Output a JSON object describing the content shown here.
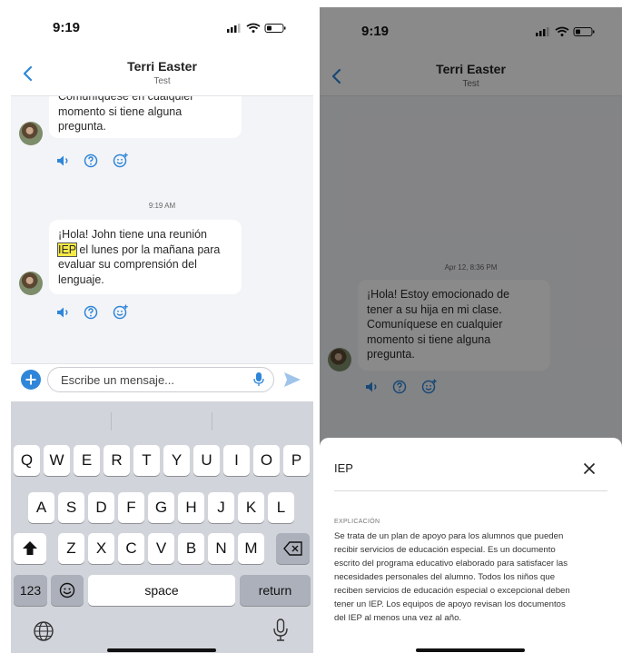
{
  "colors": {
    "accent": "#2f86d9",
    "highlight": "#f6ea47",
    "chat_bg": "#f3f4f7",
    "keyboard_bg": "#d1d4da"
  },
  "left": {
    "status_time": "9:19",
    "header_title": "Terri Easter",
    "header_subtitle": "Test",
    "message1_lines": [
      "Comuníquese en cualquier",
      "momento si tiene alguna",
      "pregunta."
    ],
    "timestamp": "9:19 AM",
    "message2": {
      "line1": "¡Hola! John tiene una reunión",
      "highlight": "IEP",
      "line2_rest": " el lunes por la mañana para",
      "line3": "evaluar su comprensión del",
      "line4": "lenguaje."
    },
    "composer_placeholder": "Escribe un mensaje...",
    "keyboard": {
      "row1": [
        "Q",
        "W",
        "E",
        "R",
        "T",
        "Y",
        "U",
        "I",
        "O",
        "P"
      ],
      "row2": [
        "A",
        "S",
        "D",
        "F",
        "G",
        "H",
        "J",
        "K",
        "L"
      ],
      "row3": [
        "Z",
        "X",
        "C",
        "V",
        "B",
        "N",
        "M"
      ],
      "numbers_label": "123",
      "space_label": "space",
      "return_label": "return"
    }
  },
  "right": {
    "status_time": "9:19",
    "header_title": "Terri Easter",
    "header_subtitle": "Test",
    "timestamp": "Apr 12, 8:36 PM",
    "message_lines": [
      "¡Hola! Estoy emocionado de",
      "tener a su hija en mi clase.",
      "Comuníquese en cualquier",
      "momento si tiene alguna",
      "pregunta."
    ],
    "sheet": {
      "title": "IEP",
      "section_label": "EXPLICACIÓN",
      "body_lines": [
        "Se trata de un plan de apoyo para los alumnos que pueden",
        "recibir servicios de educación especial. Es un documento",
        "escrito del programa educativo elaborado para satisfacer las",
        "necesidades personales del alumno. Todos los niños que",
        "reciben servicios de educación especial o excepcional deben",
        "tener un IEP. Los equipos de apoyo revisan los documentos",
        "del IEP al menos una vez al año."
      ]
    }
  }
}
